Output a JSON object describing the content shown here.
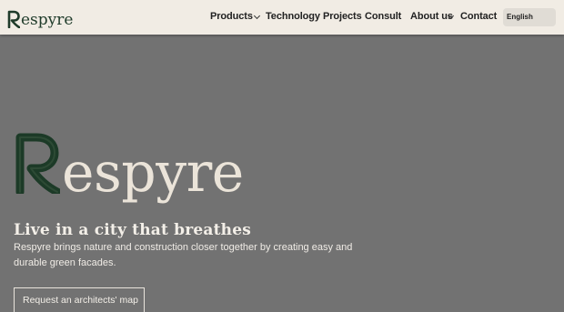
{
  "brand": {
    "name": "espyre"
  },
  "nav": {
    "items": [
      {
        "label": "Products"
      },
      {
        "label": "Technology"
      },
      {
        "label": "Projects"
      },
      {
        "label": "Consult"
      },
      {
        "label": "About us"
      },
      {
        "label": "Contact"
      }
    ],
    "language": "English"
  },
  "hero": {
    "logo_word": "espyre",
    "tagline": "Live in a city that breathes",
    "description": "Respyre brings nature and construction closer together by creating easy and durable green facades.",
    "cta": "Request an architects' map"
  },
  "colors": {
    "header_bg": "#f1ece4",
    "hero_bg": "#727272",
    "brand_green": "#1f3b2a",
    "hero_text": "#ebe4d9"
  }
}
